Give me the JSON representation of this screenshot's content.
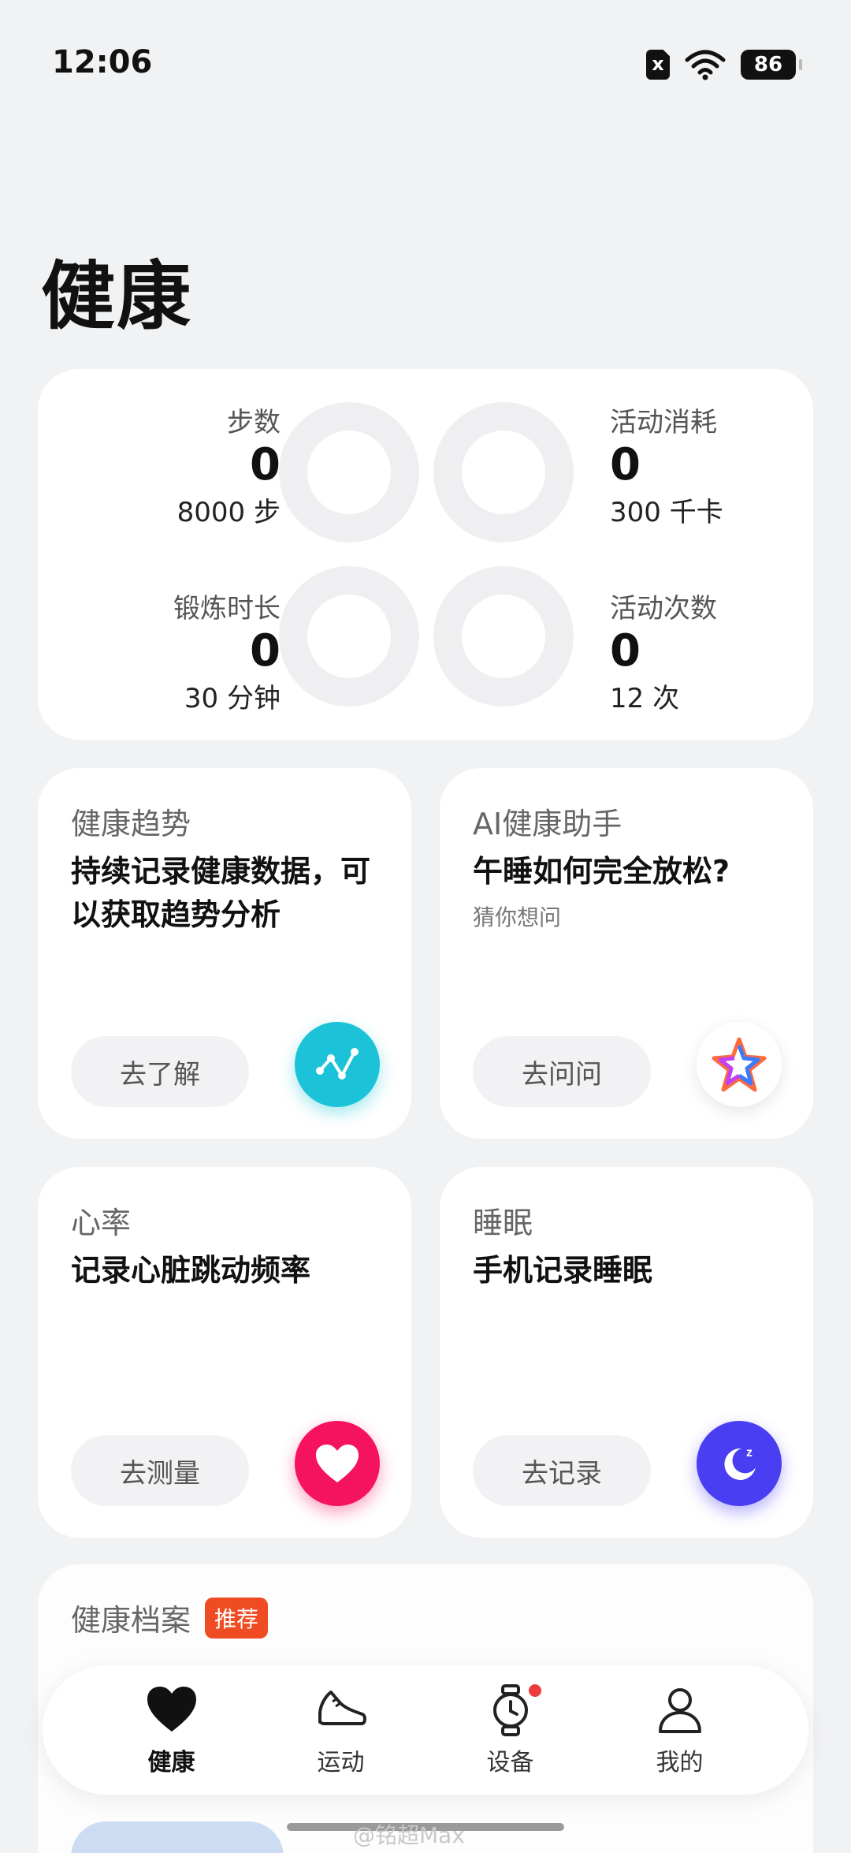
{
  "status": {
    "time": "12:06",
    "battery": "86",
    "sim_label": "x"
  },
  "page": {
    "title": "健康"
  },
  "summary": {
    "steps": {
      "label": "步数",
      "value": "0",
      "goal": "8000 步"
    },
    "calories": {
      "label": "活动消耗",
      "value": "0",
      "goal": "300 千卡"
    },
    "exercise": {
      "label": "锻炼时长",
      "value": "0",
      "goal": "30 分钟"
    },
    "activity": {
      "label": "活动次数",
      "value": "0",
      "goal": "12 次"
    }
  },
  "tiles": {
    "trend": {
      "title": "健康趋势",
      "headline": "持续记录健康数据，可以获取趋势分析",
      "button": "去了解",
      "icon": "trend-chart-icon",
      "color": "#1cc3d8"
    },
    "ai": {
      "title": "AI健康助手",
      "headline": "午睡如何完全放松?",
      "subtitle": "猜你想问",
      "button": "去问问",
      "icon": "ai-star-icon"
    },
    "heart": {
      "title": "心率",
      "headline": "记录心脏跳动频率",
      "button": "去测量",
      "icon": "heart-icon",
      "color": "#f5135f"
    },
    "sleep": {
      "title": "睡眠",
      "headline": "手机记录睡眠",
      "button": "去记录",
      "icon": "moon-icon",
      "color": "#4a3ef2"
    }
  },
  "profile": {
    "title": "健康档案",
    "badge": "推荐"
  },
  "tabbar": {
    "items": [
      {
        "label": "健康",
        "icon": "heart-icon",
        "active": true
      },
      {
        "label": "运动",
        "icon": "shoe-icon"
      },
      {
        "label": "设备",
        "icon": "watch-icon",
        "dot": true
      },
      {
        "label": "我的",
        "icon": "person-icon"
      }
    ]
  },
  "watermark": "@铭超Max"
}
